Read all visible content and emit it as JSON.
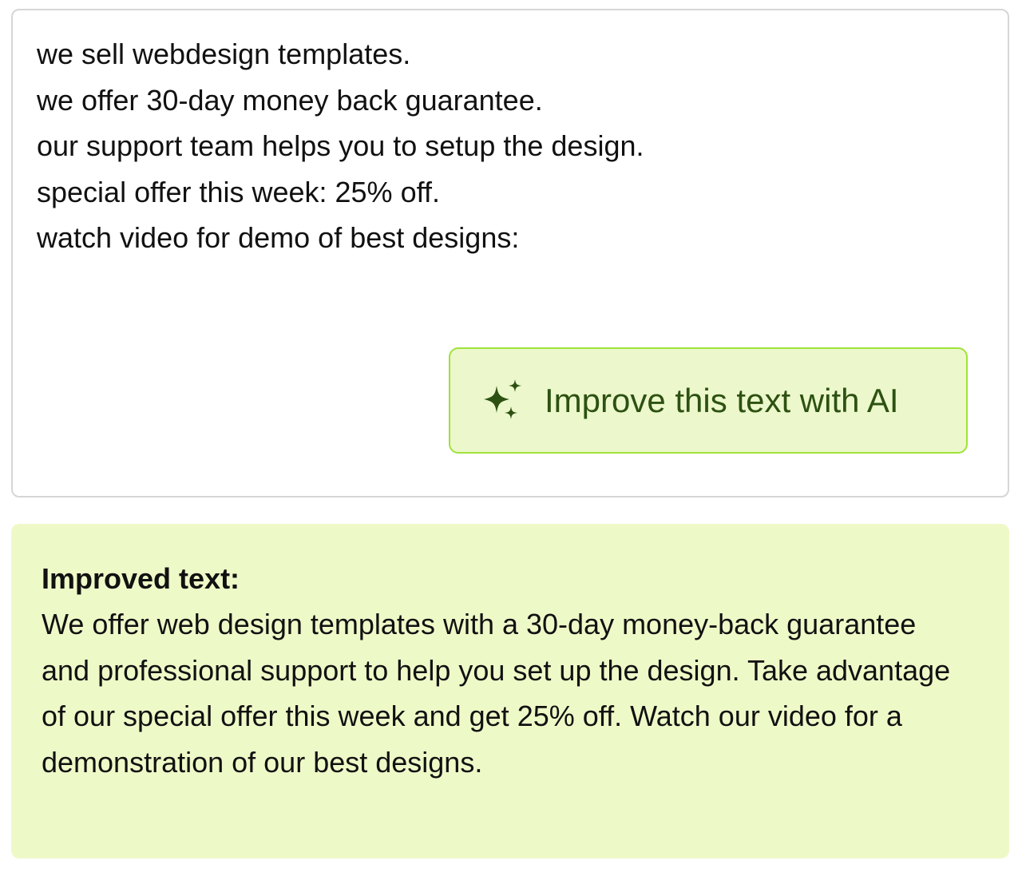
{
  "editor": {
    "lines": [
      "we sell webdesign templates.",
      "we offer 30-day money back guarantee.",
      "our support team helps you to setup the design.",
      "special offer this week: 25% off.",
      "watch video for demo of best designs:"
    ],
    "improve_button": {
      "icon": "sparkle-icon",
      "label": "Improve this text with AI"
    }
  },
  "result": {
    "heading": "Improved text:",
    "body": "We offer web design templates with a 30-day money-back guarantee and professional support to help you set up the design. Take advantage of our special offer this week and get 25% off. Watch our video for a demonstration of our best designs."
  },
  "colors": {
    "button_border": "#9fe23a",
    "button_background": "#ecf8cb",
    "button_text": "#2d5112",
    "result_background": "#eef9c8",
    "editor_border": "#d6d6d6"
  }
}
